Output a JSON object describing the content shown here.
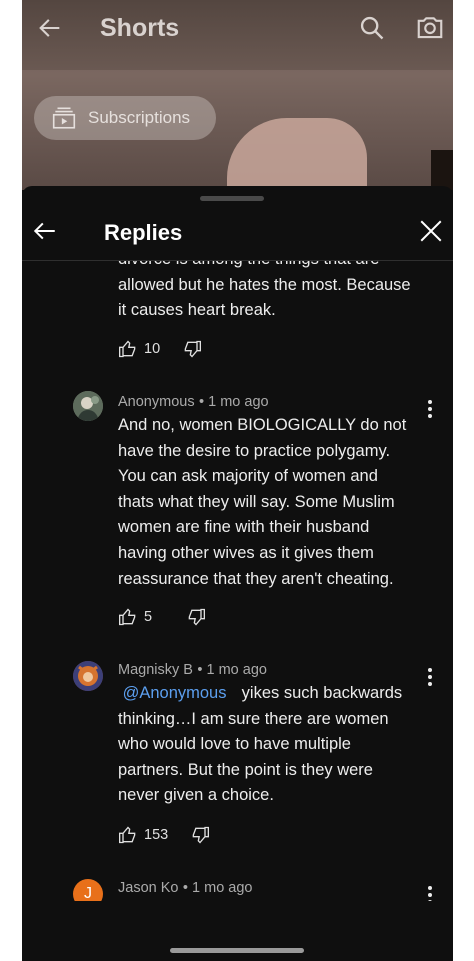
{
  "topbar": {
    "title": "Shorts",
    "chip_label": "Subscriptions"
  },
  "sheet": {
    "title": "Replies"
  },
  "partial_comment": {
    "lines": [
      "divorce is among the things that are",
      "allowed but he hates the most. Because",
      "it causes heart break."
    ],
    "likes": "10"
  },
  "comments": [
    {
      "author": "Anonymous",
      "time": "• 1 mo ago",
      "lines": [
        "And no, women BIOLOGICALLY do not",
        "have the desire to practice polygamy.",
        "You can ask majority of women and",
        "thats what they will say. Some Muslim",
        "women are fine with their husband",
        "having other wives as it gives them",
        "reassurance that they aren't cheating."
      ],
      "likes": "5"
    },
    {
      "author": "Magnisky B",
      "time": "• 1 mo ago",
      "mention": "@Anonymous",
      "first_line": "yikes such backwards",
      "lines": [
        "thinking…I am sure there are women",
        "who would love to have multiple",
        "partners. But the point is they were",
        "never given a choice."
      ],
      "likes": "153"
    },
    {
      "author": "Jason Ko",
      "time": "• 1 mo ago",
      "avatar_letter": "J"
    }
  ],
  "colors": {
    "accent_link": "#5c9fef",
    "background": "#0f0f0f",
    "avatar_j": "#e8701a"
  },
  "icons": [
    "back-arrow-icon",
    "search-icon",
    "camera-icon",
    "subscriptions-icon",
    "close-icon",
    "thumb-up-icon",
    "thumb-down-icon",
    "more-vert-icon"
  ]
}
